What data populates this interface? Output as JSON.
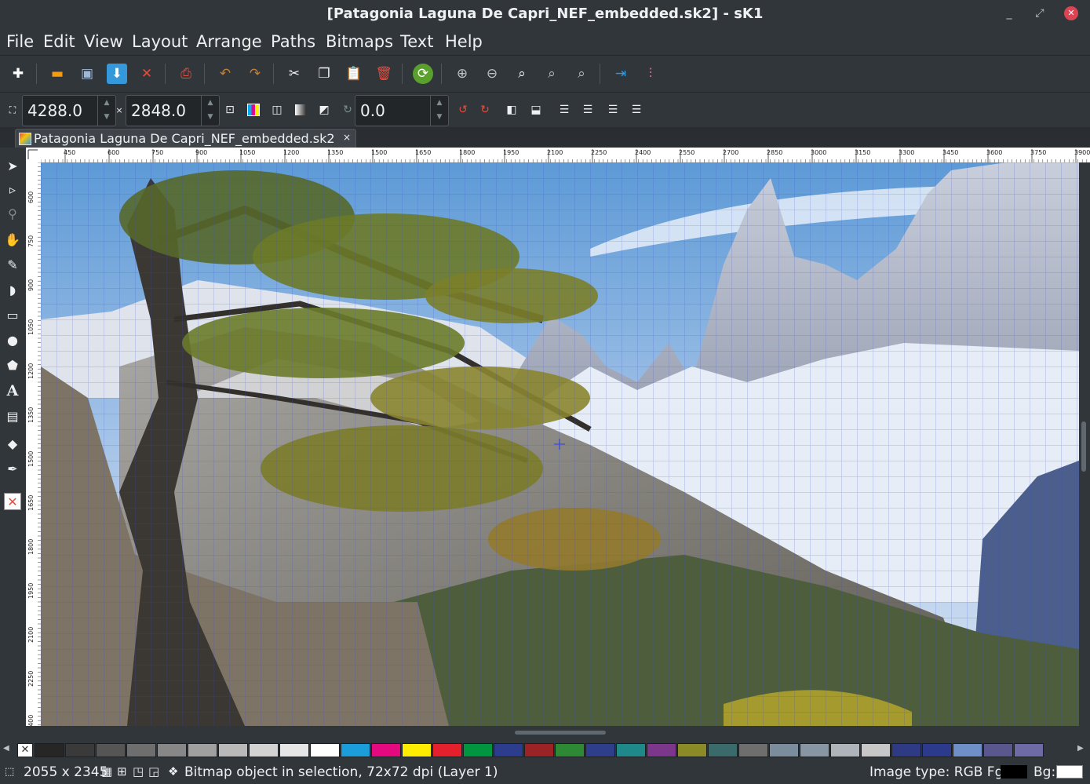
{
  "window": {
    "title": "[Patagonia Laguna De Capri_NEF_embedded.sk2] - sK1",
    "minimize_glyph": "_",
    "restore_glyph": "⤢",
    "close_glyph": "✕"
  },
  "menu": [
    "File",
    "Edit",
    "View",
    "Layout",
    "Arrange",
    "Paths",
    "Bitmaps",
    "Text",
    "Help"
  ],
  "toolbar": {
    "icons": [
      "new-icon",
      "open-icon",
      "save-icon",
      "save-as-icon",
      "close-doc-icon",
      "print-icon",
      "undo-icon",
      "redo-icon",
      "cut-icon",
      "copy-icon",
      "paste-icon",
      "delete-icon",
      "refresh-icon",
      "zoom-in-icon",
      "zoom-out-icon",
      "zoom-page-icon",
      "zoom-selection-icon",
      "zoom-100-icon",
      "import-icon",
      "properties-icon"
    ],
    "glyphs": [
      "✚",
      "▬",
      "▣",
      "⬇",
      "✕",
      "⎙",
      "↶",
      "↷",
      "✂",
      "❐",
      "📋",
      "🗑",
      "⟳",
      "⊕",
      "⊖",
      "⌕",
      "⌕",
      "⌕",
      "⇥",
      "⫶"
    ]
  },
  "properties": {
    "width": "4288.0",
    "height": "2848.0",
    "size_separator": "×",
    "rotation": "0.0",
    "up_arrow": "▲",
    "down_arrow": "▼"
  },
  "tab": {
    "label": "Patagonia Laguna De Capri_NEF_embedded.sk2",
    "close_glyph": "×"
  },
  "ruler": {
    "h_ticks": [
      "450",
      "600",
      "750",
      "900",
      "1050",
      "1200",
      "1350",
      "1500",
      "1650",
      "1800",
      "1950",
      "2100",
      "2250",
      "2400",
      "2550",
      "2700",
      "2850",
      "3000",
      "3150",
      "3300",
      "3450",
      "3600",
      "3750",
      "3900"
    ],
    "v_ticks": [
      "600",
      "750",
      "900",
      "1050",
      "1200",
      "1350",
      "1500",
      "1650",
      "1800",
      "1950",
      "2100",
      "2250",
      "2400"
    ]
  },
  "tools": {
    "icons": [
      "selection-arrow-icon",
      "node-arrow-icon",
      "zoom-tool-icon",
      "fleur-hand-icon",
      "freehand-icon",
      "curve-icon",
      "rectangle-icon",
      "ellipse-icon",
      "polygon-icon",
      "text-tool-icon",
      "gradient-icon",
      "fill-icon",
      "pen-icon",
      "no-fill-icon"
    ],
    "glyphs": [
      "➤",
      "▹",
      "⚲",
      "✋",
      "✎",
      "◗",
      "▭",
      "●",
      "⬟",
      "A",
      "▤",
      "◆",
      "✒",
      "✕"
    ]
  },
  "palette": {
    "no_color_glyph": "✕",
    "colors": [
      "#262626",
      "#3a3a3a",
      "#555555",
      "#6e6e6e",
      "#878787",
      "#a0a0a0",
      "#b9b9b9",
      "#d2d2d2",
      "#e6e6e6",
      "#ffffff",
      "#1a9dd9",
      "#e5097f",
      "#ffed00",
      "#e3202b",
      "#00963f",
      "#2c3d8e",
      "#9b2225",
      "#2e8934",
      "#2e3e8a",
      "#1f8888",
      "#7c368b",
      "#8a8b26",
      "#3b6a6a",
      "#6e6e6e",
      "#7b8c9c",
      "#8896a4",
      "#aeb4ba",
      "#c7c7c7",
      "#2e3a84",
      "#2c3a8c",
      "#6f8fc8",
      "#5a568e",
      "#6e6aa6"
    ],
    "scroll_left": "◀",
    "scroll_right": "▶"
  },
  "status": {
    "cursor_glyph": "⬚",
    "dimensions": "2055 x 2345",
    "object_glyph": "❖",
    "message": "Bitmap object in selection, 72x72 dpi (Layer 1)",
    "image_type": "Image type: RGB Fg:",
    "fg_color": "#000000",
    "bg_label": "Bg:",
    "bg_color": "#ffffff"
  }
}
